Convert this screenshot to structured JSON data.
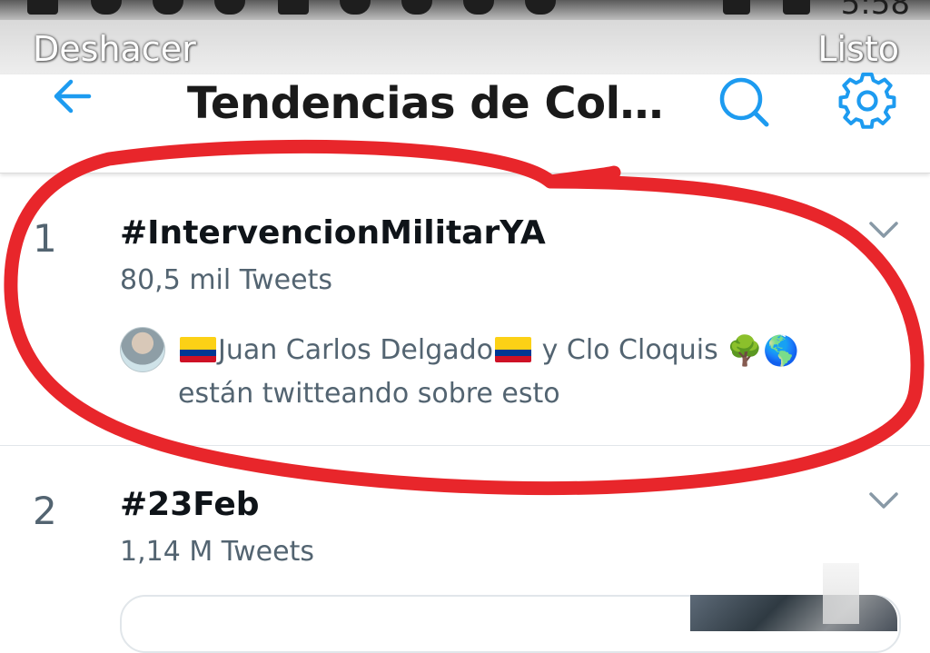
{
  "status_bar": {
    "time": "5:58"
  },
  "editor": {
    "undo_label": "Deshacer",
    "done_label": "Listo"
  },
  "header": {
    "title": "Tendencias de Col…",
    "back_icon": "arrow-left-icon",
    "search_icon": "search-icon",
    "settings_icon": "gear-icon"
  },
  "trends": [
    {
      "rank": "1",
      "hashtag": "#IntervencionMilitarYA",
      "tweet_count": "80,5 mil Tweets",
      "context": {
        "user1": "Juan Carlos Delgado",
        "connector": " y Clo Cloquis ",
        "emoji_tree": "🌳",
        "emoji_globe": "🌎",
        "suffix": "están twitteando sobre esto"
      }
    },
    {
      "rank": "2",
      "hashtag": "#23Feb",
      "tweet_count": "1,14 M Tweets"
    }
  ],
  "colors": {
    "accent": "#1d9bf0",
    "annotation": "#e8262b",
    "secondary_text": "#536471"
  }
}
